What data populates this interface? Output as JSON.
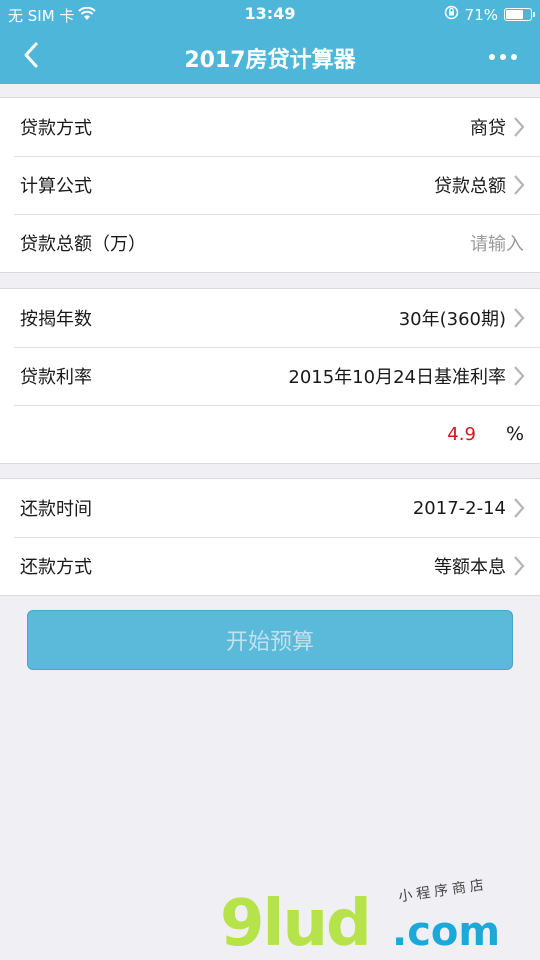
{
  "status_bar": {
    "carrier": "无 SIM 卡",
    "time": "13:49",
    "battery_percent": "71%",
    "battery_level": 0.71,
    "icons": [
      "wifi-icon",
      "orientation-lock-icon",
      "battery-icon"
    ]
  },
  "nav": {
    "title": "2017房贷计算器",
    "back_icon": "chevron-left-icon",
    "more_icon": "more-dots-icon"
  },
  "group1": {
    "loan_type": {
      "label": "贷款方式",
      "value": "商贷"
    },
    "formula": {
      "label": "计算公式",
      "value": "贷款总额"
    },
    "loan_amount": {
      "label": "贷款总额（万）",
      "placeholder": "请输入"
    }
  },
  "group2": {
    "term": {
      "label": "按揭年数",
      "value": "30年(360期)"
    },
    "rate": {
      "label": "贷款利率",
      "value": "2015年10月24日基准利率"
    },
    "rate_input": {
      "value": "4.9",
      "unit": "%"
    }
  },
  "group3": {
    "repay_time": {
      "label": "还款时间",
      "value": "2017-2-14"
    },
    "repay_method": {
      "label": "还款方式",
      "value": "等额本息"
    }
  },
  "actions": {
    "start_label": "开始预算"
  },
  "watermark": {
    "logo": "9lud",
    "domain": ".com",
    "tagline": "小程序商店"
  },
  "colors": {
    "brand": "#4eb6d8",
    "button": "#5bbad9",
    "rate_red": "#d0181c",
    "background": "#efeff4"
  }
}
